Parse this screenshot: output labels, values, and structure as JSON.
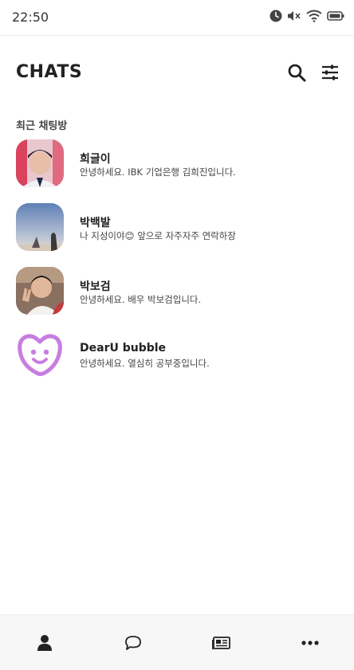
{
  "status_bar": {
    "time": "22:50",
    "icons": [
      "clock-icon",
      "mute-icon",
      "wifi-icon",
      "battery-icon"
    ]
  },
  "header": {
    "title": "CHATS",
    "icons": [
      "search-icon",
      "filter-sliders-icon"
    ]
  },
  "section_title": "최근 채팅방",
  "chats": [
    {
      "name": "희글이",
      "preview": "안녕하세요. IBK 기업은행 김희진입니다."
    },
    {
      "name": "박백발",
      "preview": "나 지성이야😊 앞으로 자주자주 연락하장"
    },
    {
      "name": "박보검",
      "preview": "안녕하세요. 배우 박보검입니다."
    },
    {
      "name": "DearU bubble",
      "preview": "안녕하세요. 열심히 공부중입니다."
    }
  ],
  "bottom_nav": {
    "items": [
      "person-icon",
      "chat-bubble-icon",
      "news-icon",
      "more-icon"
    ]
  },
  "colors": {
    "bubble_logo": "#c77de0",
    "icon_dark": "#222222",
    "nav_background": "#f7f7f7"
  }
}
